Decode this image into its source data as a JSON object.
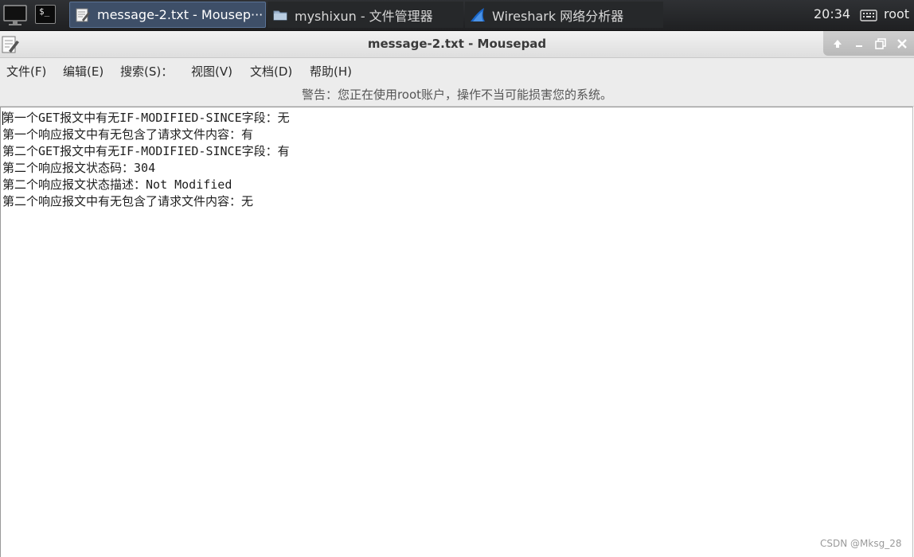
{
  "taskbar": {
    "tasks": [
      {
        "label": "message-2.txt - Mousep···",
        "icon": "text-editor-icon"
      },
      {
        "label": "myshixun - 文件管理器",
        "icon": "folder-icon"
      },
      {
        "label": "Wireshark 网络分析器",
        "icon": "wireshark-fin-icon"
      }
    ],
    "clock": "20:34",
    "user": "root"
  },
  "window": {
    "title": "message-2.txt - Mousepad"
  },
  "menu": {
    "items": [
      "文件(F)",
      "编辑(E)",
      "搜索(S)：",
      "视图(V)",
      "文档(D)",
      "帮助(H)"
    ]
  },
  "warning": "警告：您正在使用root账户，操作不当可能损害您的系统。",
  "editor": {
    "lines": [
      "第一个GET报文中有无IF-MODIFIED-SINCE字段：无",
      "第一个响应报文中有无包含了请求文件内容：有",
      "第二个GET报文中有无IF-MODIFIED-SINCE字段：有",
      "第二个响应报文状态码：304",
      "第二个响应报文状态描述：Not Modified",
      "第二个响应报文中有无包含了请求文件内容：无"
    ]
  },
  "watermark": "CSDN @Mksg_28",
  "colors": {
    "panel": "#26282a",
    "active_task": "#3e4f68",
    "wireshark": "#1a66c8"
  }
}
